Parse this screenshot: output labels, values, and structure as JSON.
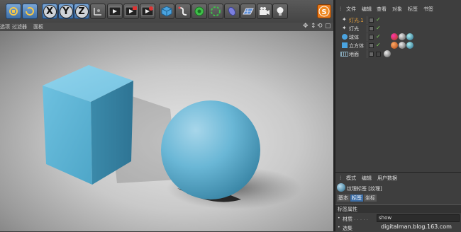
{
  "toolbar": {
    "buttons": [
      "undo-icon",
      "refresh-icon",
      "x-axis",
      "y-axis",
      "z-axis",
      "coordinate-system-icon",
      "render-view-icon",
      "render-picture-icon",
      "render-settings-icon",
      "cube-icon",
      "spline-icon",
      "nurbs-icon",
      "array-icon",
      "deformer-icon",
      "floor-icon",
      "camera-icon",
      "light-icon",
      "s-icon"
    ],
    "axis_x": "X",
    "axis_y": "Y",
    "axis_z": "Z"
  },
  "viewport": {
    "menu": [
      "选项",
      "过滤器",
      "面板"
    ]
  },
  "object_manager": {
    "menu": [
      "文件",
      "编辑",
      "查看",
      "对象",
      "标签",
      "书签"
    ],
    "objects": [
      {
        "name": "灯光.1",
        "color": "#e8a03a"
      },
      {
        "name": "灯光",
        "color": "#dddddd"
      },
      {
        "name": "球体",
        "color": "#dddddd"
      },
      {
        "name": "立方体",
        "color": "#dddddd"
      },
      {
        "name": "地面",
        "color": "#dddddd"
      }
    ],
    "check": "✓"
  },
  "attribute_manager": {
    "menu": [
      "模式",
      "编辑",
      "用户数据"
    ],
    "tag_title": "纹理标签 [纹理]",
    "tabs": [
      "基本",
      "标签",
      "坐标"
    ],
    "section": "标签属性",
    "field_label": "材质",
    "field_value": "show",
    "field2_label": "选集"
  },
  "watermark": "digitalman.blog.163.com",
  "colors": {
    "toolbar_bg": "#4e4e4e",
    "panel_bg": "#3e3e3e",
    "accent": "#e8a03a",
    "sphere": "#6ab7d6"
  }
}
